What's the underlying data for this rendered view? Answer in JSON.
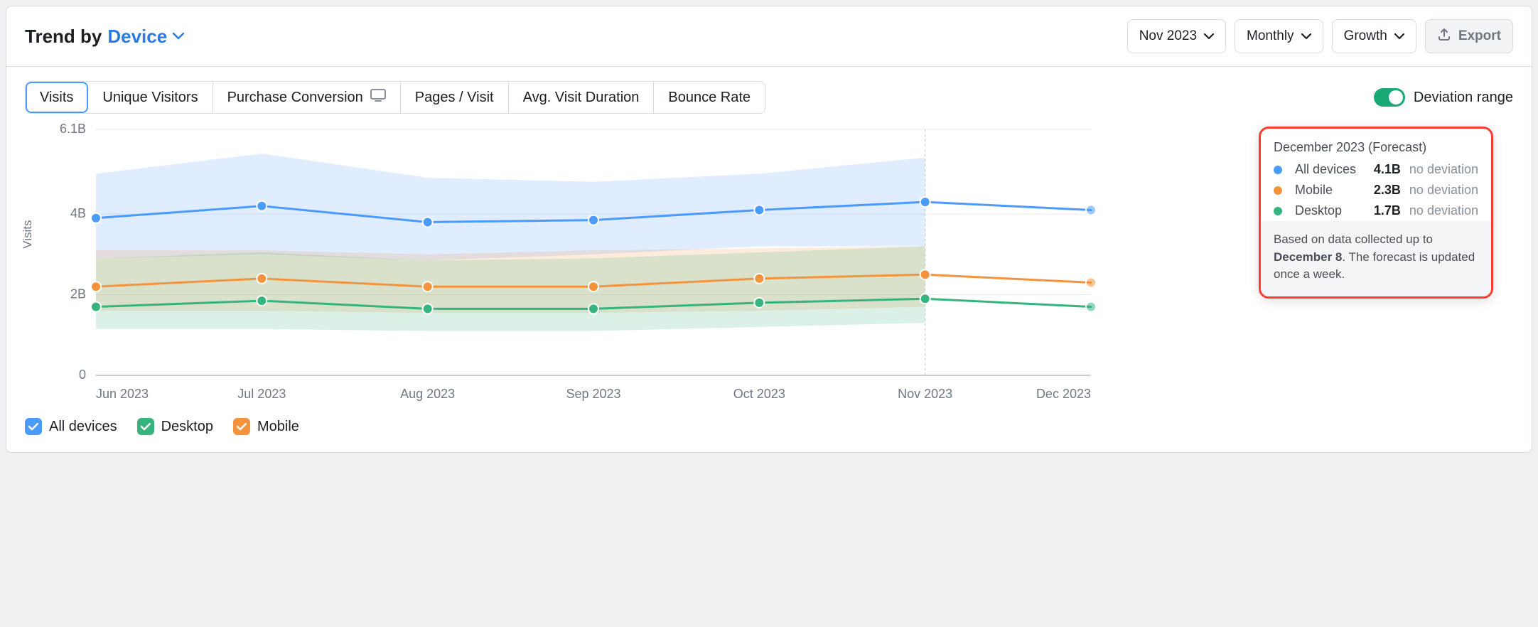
{
  "header": {
    "title_prefix": "Trend by",
    "dimension": "Device"
  },
  "controls": {
    "date": "Nov 2023",
    "granularity": "Monthly",
    "mode": "Growth",
    "export": "Export"
  },
  "tabs": [
    {
      "id": "visits",
      "label": "Visits",
      "active": true
    },
    {
      "id": "uniques",
      "label": "Unique Visitors"
    },
    {
      "id": "purchase",
      "label": "Purchase Conversion",
      "icon": "desktop"
    },
    {
      "id": "ppv",
      "label": "Pages / Visit"
    },
    {
      "id": "avd",
      "label": "Avg. Visit Duration"
    },
    {
      "id": "bounce",
      "label": "Bounce Rate"
    }
  ],
  "toggle": {
    "label": "Deviation range",
    "on": true
  },
  "ylabel": "Visits",
  "legend": [
    {
      "id": "all",
      "label": "All devices",
      "color": "#4b9bff"
    },
    {
      "id": "desktop",
      "label": "Desktop",
      "color": "#35b47e"
    },
    {
      "id": "mobile",
      "label": "Mobile",
      "color": "#f5933c"
    }
  ],
  "tooltip": {
    "title": "December 2023 (Forecast)",
    "rows": [
      {
        "label": "All devices",
        "value": "4.1B",
        "deviation": "no deviation",
        "color": "#4b9bff"
      },
      {
        "label": "Mobile",
        "value": "2.3B",
        "deviation": "no deviation",
        "color": "#f5933c"
      },
      {
        "label": "Desktop",
        "value": "1.7B",
        "deviation": "no deviation",
        "color": "#35b47e"
      }
    ],
    "footer_pre": "Based on data collected up to ",
    "footer_bold": "December 8",
    "footer_post": ". The forecast is updated once a week."
  },
  "chart_data": {
    "type": "line",
    "title": "Trend by Device — Visits",
    "xlabel": "",
    "ylabel": "Visits",
    "ylim": [
      0,
      6.1
    ],
    "y_unit": "B",
    "y_ticks": [
      0,
      2,
      4,
      6.1
    ],
    "y_tick_labels": [
      "0",
      "2B",
      "4B",
      "6.1B"
    ],
    "categories": [
      "Jun 2023",
      "Jul 2023",
      "Aug 2023",
      "Sep 2023",
      "Oct 2023",
      "Nov 2023",
      "Dec 2023"
    ],
    "series": [
      {
        "name": "All devices",
        "color": "#4b9bff",
        "values": [
          3.9,
          4.2,
          3.8,
          3.85,
          4.1,
          4.3,
          4.1
        ],
        "band_lo": [
          2.9,
          3.0,
          2.85,
          3.0,
          3.2,
          3.2,
          null
        ],
        "band_hi": [
          5.0,
          5.5,
          4.9,
          4.8,
          5.0,
          5.4,
          null
        ]
      },
      {
        "name": "Mobile",
        "color": "#f5933c",
        "values": [
          2.2,
          2.4,
          2.2,
          2.2,
          2.4,
          2.5,
          2.3
        ],
        "band_lo": [
          1.6,
          1.6,
          1.55,
          1.55,
          1.6,
          1.7,
          null
        ],
        "band_hi": [
          3.1,
          3.1,
          3.0,
          3.1,
          3.15,
          3.2,
          null
        ]
      },
      {
        "name": "Desktop",
        "color": "#35b47e",
        "values": [
          1.7,
          1.85,
          1.65,
          1.65,
          1.8,
          1.9,
          1.7
        ],
        "band_lo": [
          1.15,
          1.15,
          1.1,
          1.1,
          1.2,
          1.3,
          null
        ],
        "band_hi": [
          2.9,
          3.05,
          2.85,
          2.9,
          3.05,
          3.2,
          null
        ]
      }
    ],
    "forecast_index": 6,
    "deviation_range_shown": true
  }
}
